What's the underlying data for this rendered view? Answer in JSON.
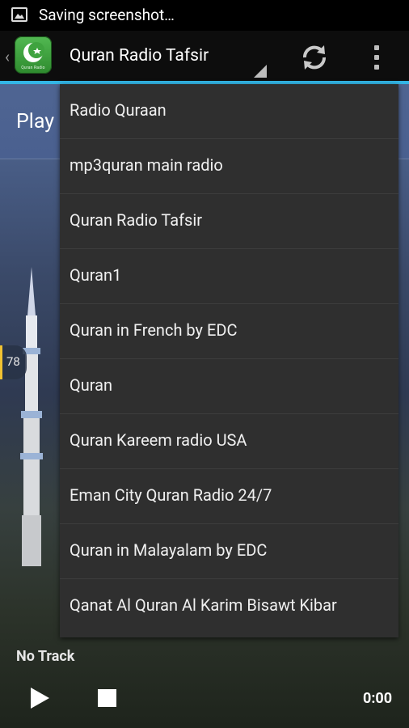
{
  "status_bar": {
    "notification_text": "Saving screenshot…"
  },
  "action_bar": {
    "app_name": "Quran Radio",
    "selected_station": "Quran Radio Tafsir"
  },
  "player": {
    "play_label": "Play",
    "track_number": "78",
    "track_status": "No Track",
    "time": "0:00"
  },
  "dropdown": {
    "items": [
      "Radio Quraan",
      "mp3quran main radio",
      "Quran Radio Tafsir",
      "Quran1",
      "Quran in French by EDC",
      "Quran",
      "Quran Kareem radio USA",
      "Eman City Quran Radio 24/7",
      "Quran in Malayalam by EDC",
      "Qanat Al Quran Al Karim Bisawt Kibar"
    ]
  },
  "colors": {
    "accent": "#33b5e5",
    "menu_bg": "#2f2f2f",
    "logo_green": "#3fa33f"
  }
}
